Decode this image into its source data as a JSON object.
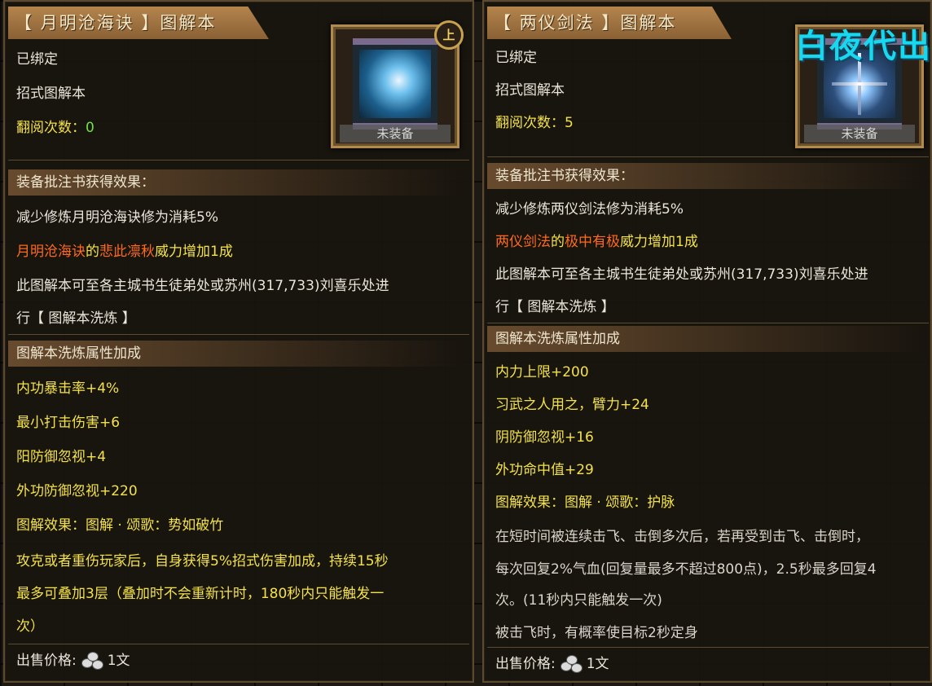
{
  "left_tooltip": {
    "title": "【 月明沧海诀 】图解本",
    "equip_tag": "未装备",
    "level_badge": "上",
    "bound": "已绑定",
    "type": "招式图解本",
    "read_count_label": "翻阅次数：",
    "read_count_value": "0",
    "effects_header": "装备批注书获得效果：",
    "effect_reduce": "减少修炼月明沧海诀修为消耗5%",
    "effect_power": {
      "skill": "月明沧海诀",
      "de": "的",
      "move": "悲此凛秋",
      "rest": "威力增加1成"
    },
    "refine_info_1": "此图解本可至各主城书生徒弟处或苏州(317,733)刘喜乐处进",
    "refine_info_2": "行【 图解本洗炼 】",
    "refine_header": "图解本洗炼属性加成",
    "attributes": [
      "内功暴击率+4%",
      "最小打击伤害+6",
      "阳防御忽视+4",
      "外功防御忽视+220"
    ],
    "effect_title": "图解效果：图解 · 颂歌：势如破竹",
    "effect_desc": [
      "攻克或者重伤玩家后，自身获得5%招式伤害加成，持续15秒",
      "最多可叠加3层（叠加时不会重新计时，180秒内只能触发一",
      "次）"
    ],
    "sell_label": "出售价格:",
    "sell_value": "1文"
  },
  "right_tooltip": {
    "title": "【 两仪剑法 】图解本",
    "equip_tag": "未装备",
    "bound": "已绑定",
    "type": "招式图解本",
    "read_count_label": "翻阅次数：",
    "read_count_value": "5",
    "effects_header": "装备批注书获得效果：",
    "effect_reduce": "减少修炼两仪剑法修为消耗5%",
    "effect_power": {
      "skill": "两仪剑法",
      "de": "的",
      "move": "极中有极",
      "rest": "威力增加1成"
    },
    "refine_info_1": "此图解本可至各主城书生徒弟处或苏州(317,733)刘喜乐处进",
    "refine_info_2": "行【 图解本洗炼 】",
    "refine_header": "图解本洗炼属性加成",
    "attributes": [
      "内力上限+200",
      "习武之人用之，臂力+24",
      "阴防御忽视+16",
      "外功命中值+29"
    ],
    "effect_title": "图解效果：图解 · 颂歌：护脉",
    "effect_desc": [
      "在短时间被连续击飞、击倒多次后，若再受到击飞、击倒时，",
      "每次回复2%气血(回复量最多不超过800点)，2.5秒最多回复4",
      "次。(11秒内只能触发一次)",
      "被击飞时，有概率使目标2秒定身"
    ],
    "sell_label": "出售价格:",
    "sell_value": "1文"
  },
  "watermark": "白夜代出",
  "colors": {
    "highlight_yellow": "#f3e24a",
    "green": "#71e04a",
    "orange": "#ff6a1e"
  }
}
